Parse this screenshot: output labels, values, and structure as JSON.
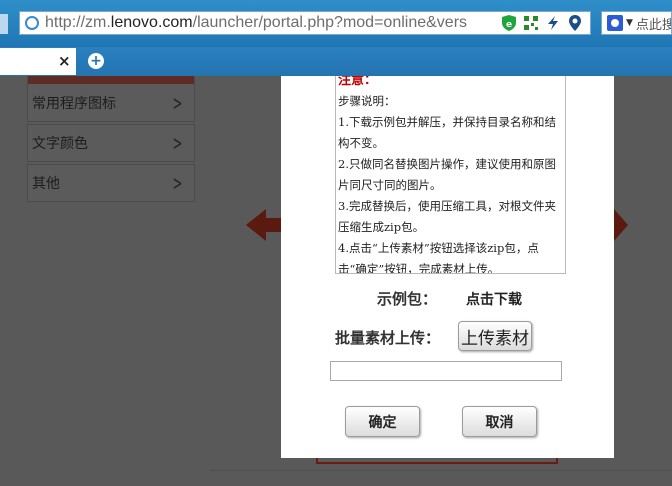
{
  "browser": {
    "url_prefix": "http://zm.",
    "url_host": "lenovo.com",
    "url_rest": "/launcher/portal.php?mod=online&vers",
    "search_placeholder": "点此搜",
    "tab_close": "×",
    "icons": [
      "globe-icon",
      "shield-icon",
      "qr-code-icon",
      "lightning-icon",
      "location-pin-icon",
      "search-engine-icon",
      "new-tab-icon"
    ]
  },
  "sidebar": {
    "items": [
      {
        "label": "常用程序图标"
      },
      {
        "label": "文字颜色"
      },
      {
        "label": "其他"
      }
    ]
  },
  "dialog": {
    "notes": {
      "title": "注意：",
      "lines": [
        "步骤说明：",
        "1.下载示例包并解压，并保持目录名称和结构不变。",
        "2.只做同名替换图片操作，建议使用和原图片同尺寸同的图片。",
        "3.完成替换后，使用压缩工具，对根文件夹压缩生成zip包。",
        "4.点击“上传素材”按钮选择该zip包，点击“确定”按钮，完成素材上传。"
      ]
    },
    "sample_label": "示例包：",
    "download_link": "点击下载",
    "batch_upload_label": "批量素材上传：",
    "upload_button": "上传素材",
    "file_value": "",
    "ok_button": "确定",
    "cancel_button": "取消"
  }
}
